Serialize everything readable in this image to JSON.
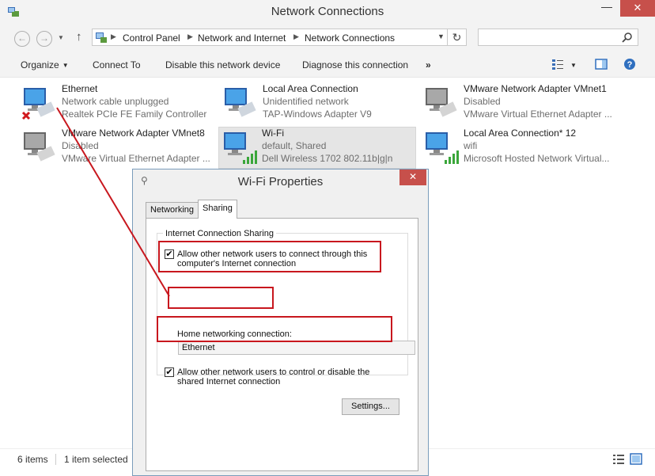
{
  "window": {
    "title": "Network Connections",
    "minimize_glyph": "—",
    "close_glyph": "✕"
  },
  "navigation": {
    "back_glyph": "←",
    "forward_glyph": "→",
    "up_glyph": "↑",
    "breadcrumbs": [
      "Control Panel",
      "Network and Internet",
      "Network Connections"
    ],
    "separator_glyph": "▶",
    "dropdown_glyph": "▼",
    "refresh_glyph": "↻",
    "search_placeholder": "",
    "search_glyph": "⚲"
  },
  "commands": {
    "organize": "Organize",
    "connect_to": "Connect To",
    "disable": "Disable this network device",
    "diagnose": "Diagnose this connection",
    "more": "»"
  },
  "connections": [
    {
      "name": "Ethernet",
      "status": "Network cable unplugged",
      "device": "Realtek PCIe FE Family Controller",
      "icon": "ethernet-unplugged-icon"
    },
    {
      "name": "Local Area Connection",
      "status": "Unidentified network",
      "device": "TAP-Windows Adapter V9",
      "icon": "network-adapter-icon"
    },
    {
      "name": "VMware Network Adapter VMnet1",
      "status": "Disabled",
      "device": "VMware Virtual Ethernet Adapter ...",
      "icon": "network-adapter-disabled-icon"
    },
    {
      "name": "VMware Network Adapter VMnet8",
      "status": "Disabled",
      "device": "VMware Virtual Ethernet Adapter ...",
      "icon": "network-adapter-disabled-icon"
    },
    {
      "name": "Wi-Fi",
      "status": "default, Shared",
      "device": "Dell Wireless 1702 802.11b|g|n",
      "icon": "wifi-adapter-icon"
    },
    {
      "name": "Local Area Connection* 12",
      "status": "wifi",
      "device": "Microsoft Hosted Network Virtual...",
      "icon": "wifi-adapter-icon"
    }
  ],
  "statusbar": {
    "item_count": "6 items",
    "selected": "1 item selected"
  },
  "dialog": {
    "title": "Wi-Fi Properties",
    "close_glyph": "✕",
    "tabs": [
      "Networking",
      "Sharing"
    ],
    "active_tab": "Sharing",
    "group_label": "Internet Connection Sharing",
    "allow_connect": {
      "checked": true,
      "label": "Allow other network users to connect through this computer's Internet connection"
    },
    "home_label": "Home networking connection:",
    "home_value": "Ethernet",
    "allow_control": {
      "checked": true,
      "label": "Allow other network users to control or disable the shared Internet connection"
    },
    "settings_button": "Settings...",
    "check_glyph": "✔"
  },
  "colors": {
    "accent_red": "#c8171e",
    "close_red": "#c7504b",
    "chrome_bg": "#f3f3f3"
  }
}
